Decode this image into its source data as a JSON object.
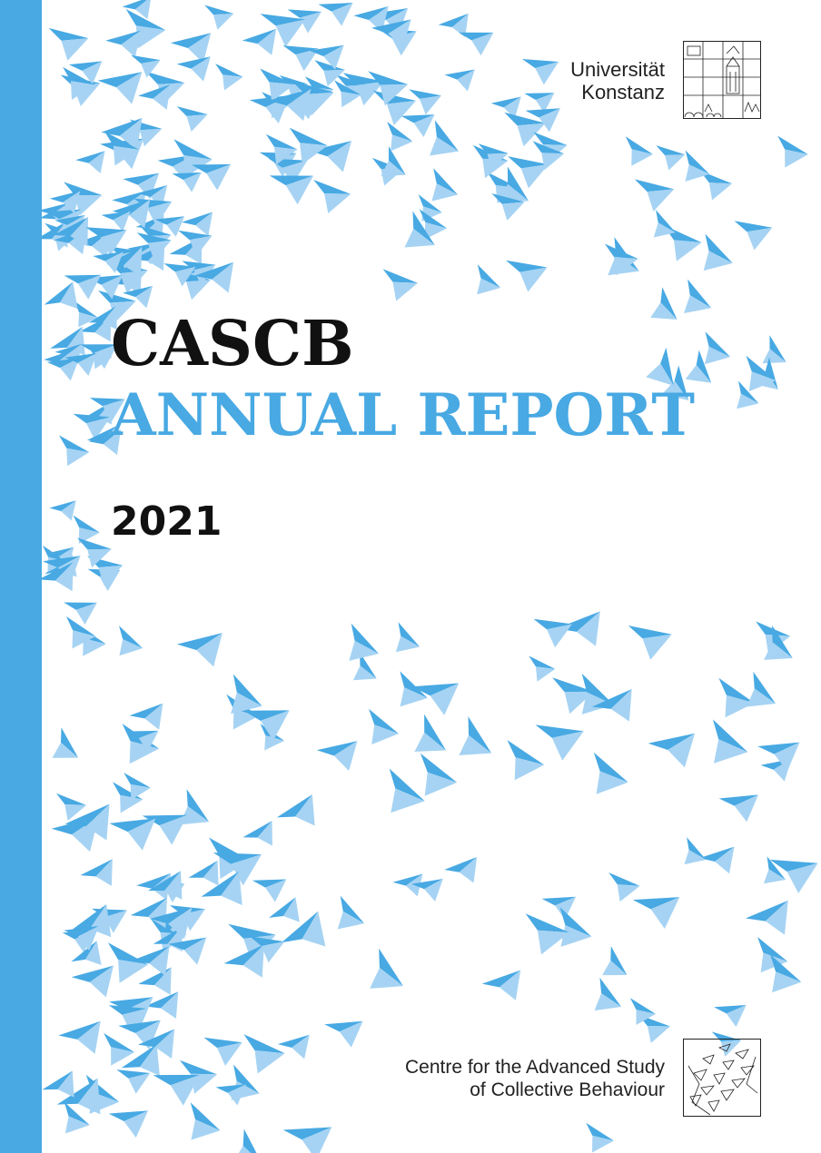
{
  "cover": {
    "title": "CASCB",
    "subtitle": "ANNUAL REPORT",
    "year": "2021"
  },
  "university": {
    "line1": "Universität",
    "line2": "Konstanz"
  },
  "centre": {
    "line1": "Centre for the Advanced Study",
    "line2": "of Collective Behaviour"
  },
  "colors": {
    "accent": "#48a9e3",
    "accent_light": "#a6d3f3",
    "text": "#111111"
  }
}
